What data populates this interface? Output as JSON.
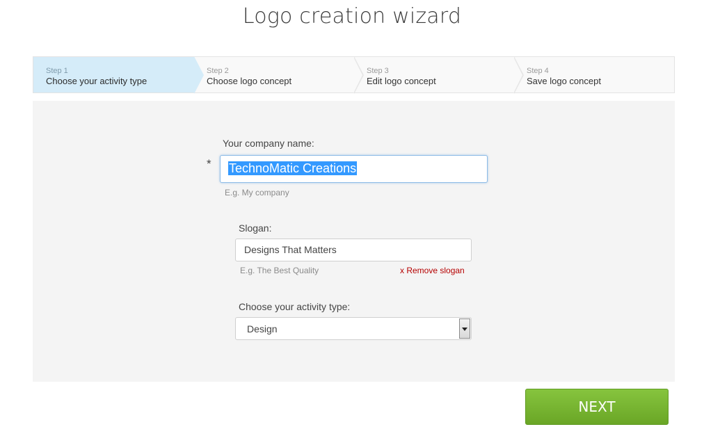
{
  "page": {
    "title": "Logo creation wizard"
  },
  "steps": [
    {
      "number": "Step 1",
      "label": "Choose your activity type",
      "active": true
    },
    {
      "number": "Step 2",
      "label": "Choose logo concept",
      "active": false
    },
    {
      "number": "Step 3",
      "label": "Edit logo concept",
      "active": false
    },
    {
      "number": "Step 4",
      "label": "Save logo concept",
      "active": false
    }
  ],
  "form": {
    "company": {
      "label": "Your company name:",
      "required_mark": "*",
      "value": "TechnoMatic Creations",
      "hint": "E.g. My company"
    },
    "slogan": {
      "label": "Slogan:",
      "value": "Designs That Matters",
      "hint": "E.g. The Best Quality",
      "remove_label": "x Remove slogan"
    },
    "activity": {
      "label": "Choose your activity type:",
      "selected": "Design"
    }
  },
  "actions": {
    "next_label": "NEXT"
  },
  "colors": {
    "active_step": "#d5ecf9",
    "next_button": "#7ab632",
    "remove_link": "#b50000",
    "selection": "#3399ff"
  }
}
